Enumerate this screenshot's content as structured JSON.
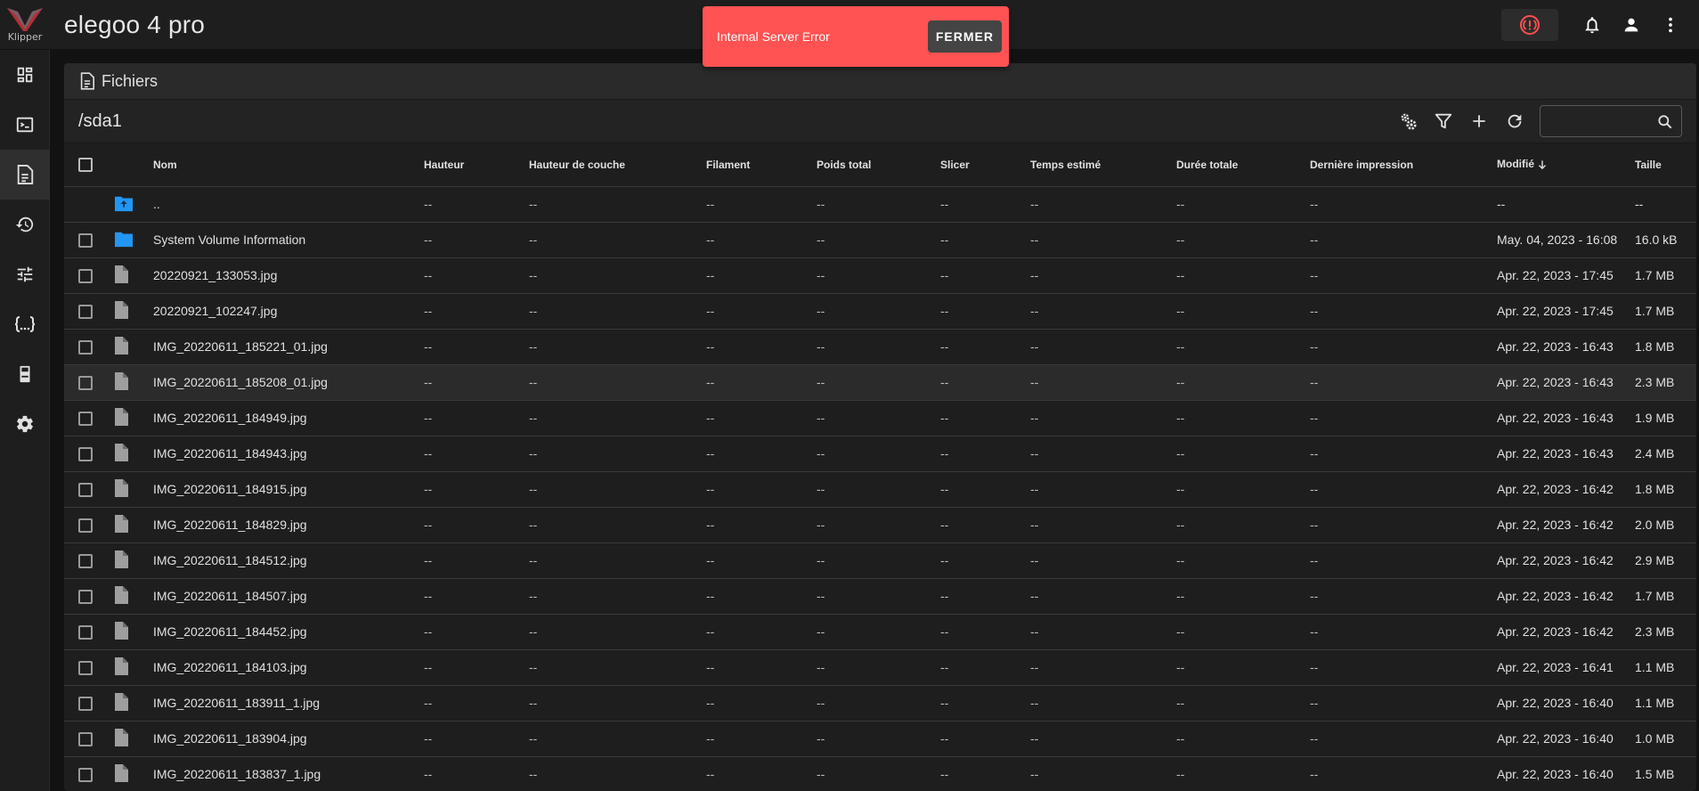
{
  "app": {
    "logo_text": "Klipper",
    "title": "elegoo 4 pro"
  },
  "topbar": {
    "icons": [
      "emergency-stop-icon",
      "bell-icon",
      "account-icon",
      "more-vert-icon"
    ]
  },
  "sidenav": {
    "items": [
      "dashboard-icon",
      "console-icon",
      "files-icon",
      "history-icon",
      "tune-icon",
      "macros-icon",
      "machine-icon",
      "settings-icon"
    ]
  },
  "card": {
    "title": "Fichiers",
    "path": "/sda1",
    "search": {
      "value": "",
      "placeholder": ""
    }
  },
  "snackbar": {
    "message": "Internal Server Error",
    "button": "FERMER"
  },
  "colors": {
    "snackbar": "#ff5252",
    "folder": "#2196f3",
    "estop": "#ff4f4f",
    "background": "#121212",
    "card": "#1e1e1e"
  },
  "table": {
    "headers": [
      "Nom",
      "Hauteur",
      "Hauteur de couche",
      "Filament",
      "Poids total",
      "Slicer",
      "Temps estimé",
      "Durée totale",
      "Dernière impression",
      "Modifié",
      "Taille"
    ],
    "rows": [
      {
        "icon": "folder-up-icon",
        "name": "..",
        "c": [
          "--",
          "--",
          "--",
          "--",
          "--",
          "--",
          "--",
          "--"
        ],
        "modified": "--",
        "size": "--"
      },
      {
        "icon": "folder-icon",
        "name": "System Volume Information",
        "c": [
          "--",
          "--",
          "--",
          "--",
          "--",
          "--",
          "--",
          "--"
        ],
        "modified": "May. 04, 2023 - 16:08",
        "size": "16.0 kB"
      },
      {
        "icon": "file-icon",
        "name": "20220921_133053.jpg",
        "c": [
          "--",
          "--",
          "--",
          "--",
          "--",
          "--",
          "--",
          "--"
        ],
        "modified": "Apr. 22, 2023 - 17:45",
        "size": "1.7 MB"
      },
      {
        "icon": "file-icon",
        "name": "20220921_102247.jpg",
        "c": [
          "--",
          "--",
          "--",
          "--",
          "--",
          "--",
          "--",
          "--"
        ],
        "modified": "Apr. 22, 2023 - 17:45",
        "size": "1.7 MB"
      },
      {
        "icon": "file-icon",
        "name": "IMG_20220611_185221_01.jpg",
        "c": [
          "--",
          "--",
          "--",
          "--",
          "--",
          "--",
          "--",
          "--"
        ],
        "modified": "Apr. 22, 2023 - 16:43",
        "size": "1.8 MB"
      },
      {
        "icon": "file-icon",
        "name": "IMG_20220611_185208_01.jpg",
        "c": [
          "--",
          "--",
          "--",
          "--",
          "--",
          "--",
          "--",
          "--"
        ],
        "modified": "Apr. 22, 2023 - 16:43",
        "size": "2.3 MB"
      },
      {
        "icon": "file-icon",
        "name": "IMG_20220611_184949.jpg",
        "c": [
          "--",
          "--",
          "--",
          "--",
          "--",
          "--",
          "--",
          "--"
        ],
        "modified": "Apr. 22, 2023 - 16:43",
        "size": "1.9 MB"
      },
      {
        "icon": "file-icon",
        "name": "IMG_20220611_184943.jpg",
        "c": [
          "--",
          "--",
          "--",
          "--",
          "--",
          "--",
          "--",
          "--"
        ],
        "modified": "Apr. 22, 2023 - 16:43",
        "size": "2.4 MB"
      },
      {
        "icon": "file-icon",
        "name": "IMG_20220611_184915.jpg",
        "c": [
          "--",
          "--",
          "--",
          "--",
          "--",
          "--",
          "--",
          "--"
        ],
        "modified": "Apr. 22, 2023 - 16:42",
        "size": "1.8 MB"
      },
      {
        "icon": "file-icon",
        "name": "IMG_20220611_184829.jpg",
        "c": [
          "--",
          "--",
          "--",
          "--",
          "--",
          "--",
          "--",
          "--"
        ],
        "modified": "Apr. 22, 2023 - 16:42",
        "size": "2.0 MB"
      },
      {
        "icon": "file-icon",
        "name": "IMG_20220611_184512.jpg",
        "c": [
          "--",
          "--",
          "--",
          "--",
          "--",
          "--",
          "--",
          "--"
        ],
        "modified": "Apr. 22, 2023 - 16:42",
        "size": "2.9 MB"
      },
      {
        "icon": "file-icon",
        "name": "IMG_20220611_184507.jpg",
        "c": [
          "--",
          "--",
          "--",
          "--",
          "--",
          "--",
          "--",
          "--"
        ],
        "modified": "Apr. 22, 2023 - 16:42",
        "size": "1.7 MB"
      },
      {
        "icon": "file-icon",
        "name": "IMG_20220611_184452.jpg",
        "c": [
          "--",
          "--",
          "--",
          "--",
          "--",
          "--",
          "--",
          "--"
        ],
        "modified": "Apr. 22, 2023 - 16:42",
        "size": "2.3 MB"
      },
      {
        "icon": "file-icon",
        "name": "IMG_20220611_184103.jpg",
        "c": [
          "--",
          "--",
          "--",
          "--",
          "--",
          "--",
          "--",
          "--"
        ],
        "modified": "Apr. 22, 2023 - 16:41",
        "size": "1.1 MB"
      },
      {
        "icon": "file-icon",
        "name": "IMG_20220611_183911_1.jpg",
        "c": [
          "--",
          "--",
          "--",
          "--",
          "--",
          "--",
          "--",
          "--"
        ],
        "modified": "Apr. 22, 2023 - 16:40",
        "size": "1.1 MB"
      },
      {
        "icon": "file-icon",
        "name": "IMG_20220611_183904.jpg",
        "c": [
          "--",
          "--",
          "--",
          "--",
          "--",
          "--",
          "--",
          "--"
        ],
        "modified": "Apr. 22, 2023 - 16:40",
        "size": "1.0 MB"
      },
      {
        "icon": "file-icon",
        "name": "IMG_20220611_183837_1.jpg",
        "c": [
          "--",
          "--",
          "--",
          "--",
          "--",
          "--",
          "--",
          "--"
        ],
        "modified": "Apr. 22, 2023 - 16:40",
        "size": "1.5 MB"
      }
    ]
  }
}
